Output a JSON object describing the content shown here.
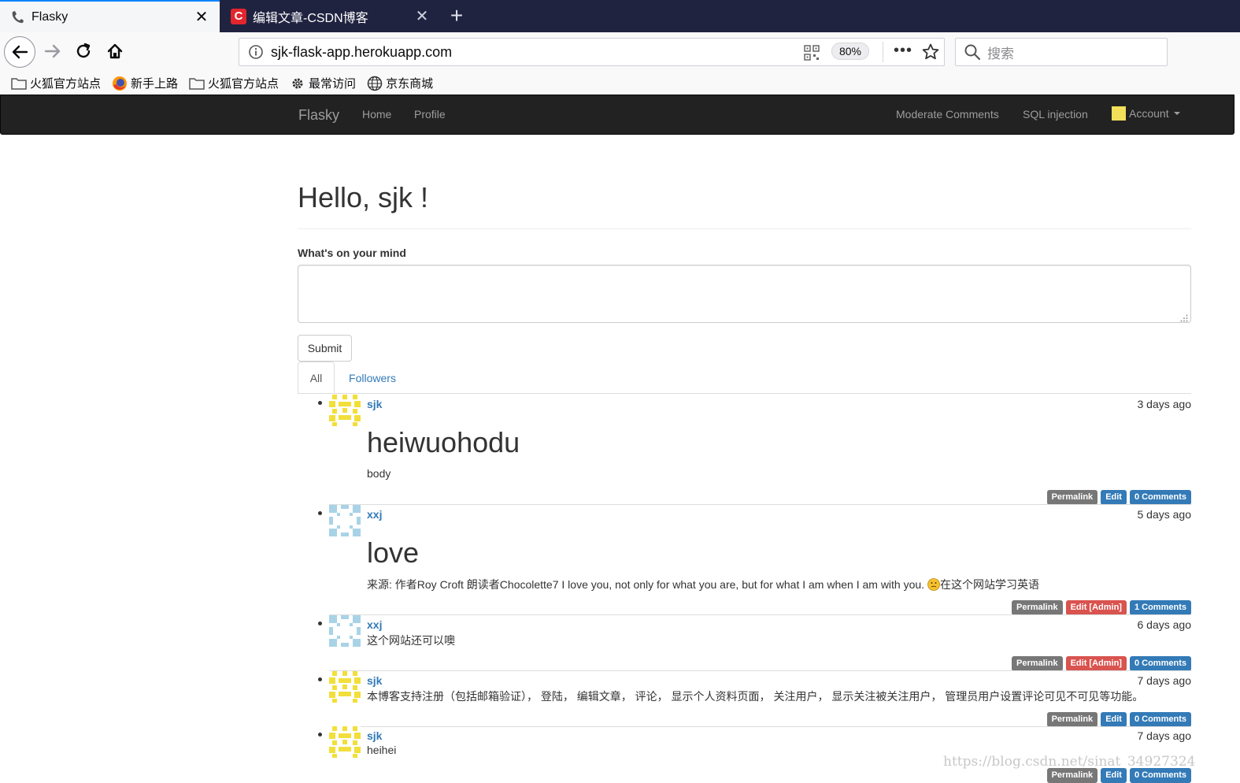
{
  "browser": {
    "tabs": [
      {
        "title": "Flasky",
        "active": true
      },
      {
        "title": "编辑文章-CSDN博客",
        "active": false
      }
    ],
    "url": "sjk-flask-app.herokuapp.com",
    "zoom": "80%",
    "more_glyph": "•••",
    "search_placeholder": "搜索",
    "bookmarks": [
      {
        "label": "火狐官方站点",
        "icon": "folder-icon"
      },
      {
        "label": "新手上路",
        "icon": "firefox-icon"
      },
      {
        "label": "火狐官方站点",
        "icon": "folder-icon"
      },
      {
        "label": "最常访问",
        "icon": "gear-icon"
      },
      {
        "label": "京东商城",
        "icon": "globe-icon"
      }
    ]
  },
  "site_nav": {
    "brand": "Flasky",
    "home": "Home",
    "profile": "Profile",
    "moderate": "Moderate Comments",
    "sql": "SQL injection",
    "account": "Account"
  },
  "page": {
    "greeting": "Hello, sjk !",
    "mind_label": "What's on your mind",
    "submit": "Submit",
    "tabs": [
      "All",
      "Followers"
    ]
  },
  "posts": [
    {
      "author": "sjk",
      "date": "3 days ago",
      "heading": "heiwuohodu",
      "body": "body",
      "labels": [
        "Permalink",
        "Edit",
        "0 Comments"
      ]
    },
    {
      "author": "xxj",
      "date": "5 days ago",
      "heading": "love",
      "body": "来源: 作者Roy Croft 朗读者Chocolette7 I love you, not only for what you are, but for what I am when I am with you.",
      "body_after": "在这个网站学习英语",
      "labels": [
        "Permalink",
        "Edit [Admin]",
        "1 Comments"
      ]
    },
    {
      "author": "xxj",
      "date": "6 days ago",
      "body": "这个网站还可以噢",
      "labels": [
        "Permalink",
        "Edit [Admin]",
        "0 Comments"
      ]
    },
    {
      "author": "sjk",
      "date": "7 days ago",
      "body": "本博客支持注册（包括邮箱验证）， 登陆， 编辑文章， 评论， 显示个人资料页面， 关注用户， 显示关注被关注用户， 管理员用户设置评论可见不可见等功能。",
      "labels": [
        "Permalink",
        "Edit",
        "0 Comments"
      ]
    },
    {
      "author": "sjk",
      "date": "7 days ago",
      "body": "heihei",
      "labels": [
        "Permalink",
        "Edit",
        "0 Comments"
      ]
    }
  ],
  "watermark": "https://blog.csdn.net/sinat_34927324",
  "colors": {
    "link": "#337ab7",
    "label_default": "#777777",
    "label_danger": "#d9534f",
    "navbar": "#222222",
    "tabstrip": "#202340"
  }
}
